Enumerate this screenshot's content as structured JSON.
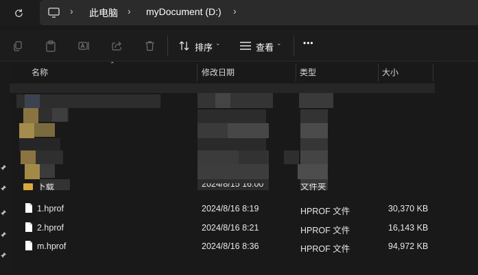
{
  "address": {
    "crumbs": [
      "此电脑",
      "myDocument (D:)"
    ]
  },
  "toolbar": {
    "sort_label": "排序",
    "view_label": "查看",
    "more_label": "•••"
  },
  "columns": {
    "name": "名称",
    "date": "修改日期",
    "type": "类型",
    "size": "大小"
  },
  "partial_row": {
    "name": "下载",
    "date": "2024/8/15 16:00",
    "type": "文件夹"
  },
  "files": [
    {
      "name": "1.hprof",
      "date": "2024/8/16 8:19",
      "type": "HPROF 文件",
      "size": "30,370 KB"
    },
    {
      "name": "2.hprof",
      "date": "2024/8/16 8:21",
      "type": "HPROF 文件",
      "size": "16,143 KB"
    },
    {
      "name": "m.hprof",
      "date": "2024/8/16 8:36",
      "type": "HPROF 文件",
      "size": "94,972 KB"
    }
  ],
  "colors": {
    "background": "#191919",
    "folder": "#d9a93d",
    "text": "#ffffff"
  }
}
